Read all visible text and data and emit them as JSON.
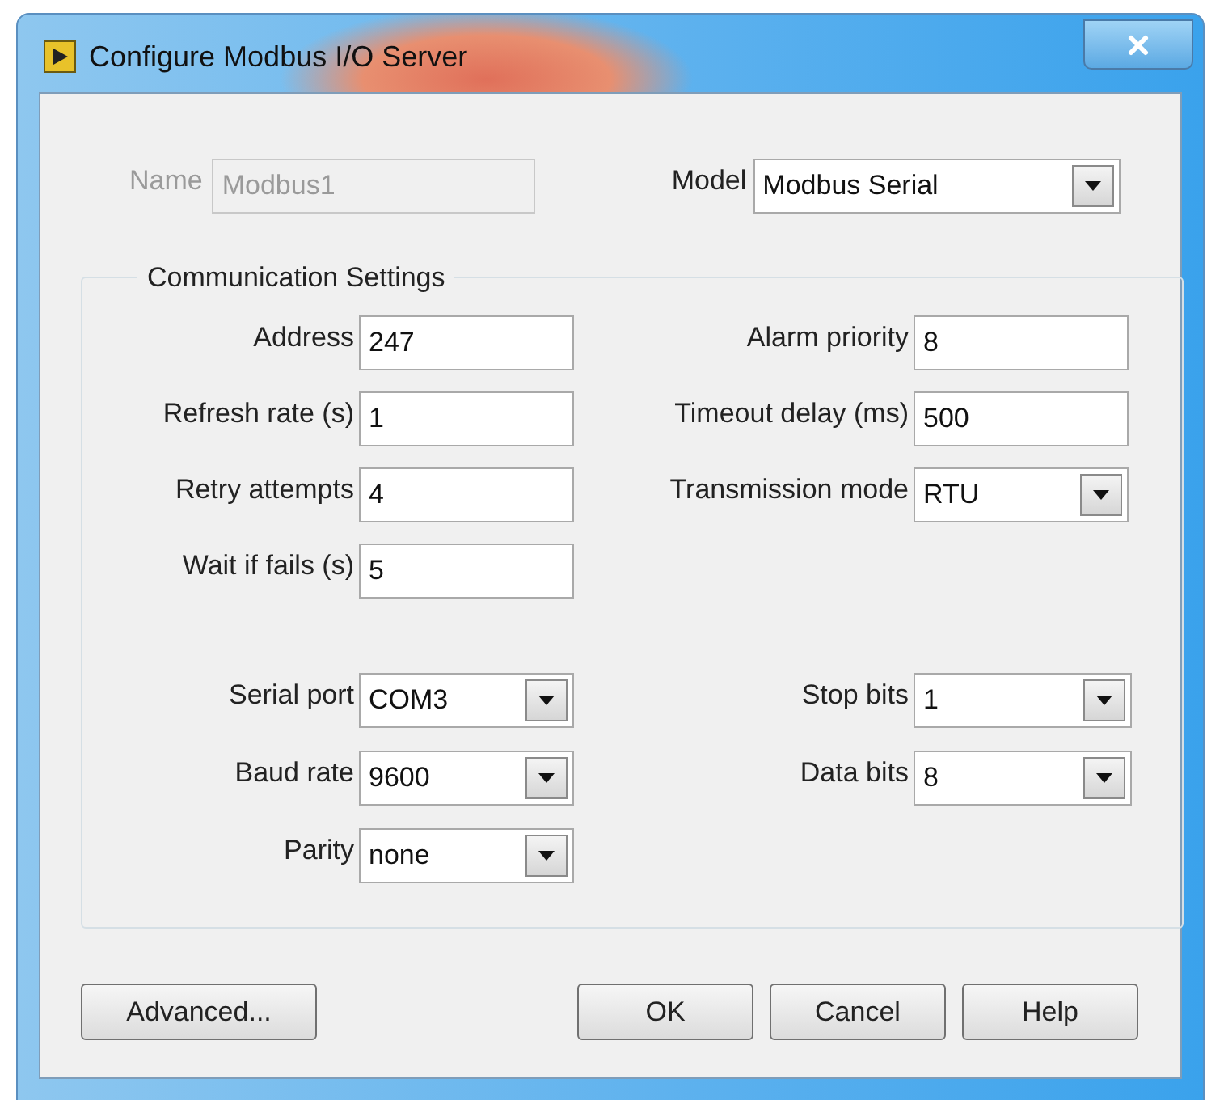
{
  "window": {
    "title": "Configure Modbus I/O Server"
  },
  "name_field": {
    "label": "Name",
    "value": "Modbus1",
    "disabled": true
  },
  "model": {
    "label": "Model",
    "value": "Modbus Serial",
    "kind": "dropdown"
  },
  "group": {
    "title": "Communication Settings",
    "left_fields": [
      {
        "label": "Address",
        "value": "247",
        "kind": "text"
      },
      {
        "label": "Refresh rate (s)",
        "value": "1",
        "kind": "text"
      },
      {
        "label": "Retry attempts",
        "value": "4",
        "kind": "text"
      },
      {
        "label": "Wait if fails (s)",
        "value": "5",
        "kind": "text"
      }
    ],
    "right_fields": [
      {
        "label": "Alarm priority",
        "value": "8",
        "kind": "text"
      },
      {
        "label": "Timeout delay (ms)",
        "value": "500",
        "kind": "text"
      },
      {
        "label": "Transmission mode",
        "value": "RTU",
        "kind": "dropdown"
      }
    ],
    "serial_left": [
      {
        "label": "Serial port",
        "value": "COM3",
        "kind": "dropdown"
      },
      {
        "label": "Baud rate",
        "value": "9600",
        "kind": "dropdown"
      },
      {
        "label": "Parity",
        "value": "none",
        "kind": "dropdown"
      }
    ],
    "serial_right": [
      {
        "label": "Stop bits",
        "value": "1",
        "kind": "dropdown"
      },
      {
        "label": "Data bits",
        "value": "8",
        "kind": "dropdown"
      }
    ]
  },
  "buttons": [
    {
      "label": "Advanced..."
    },
    {
      "label": "OK"
    },
    {
      "label": "Cancel"
    },
    {
      "label": "Help"
    }
  ]
}
